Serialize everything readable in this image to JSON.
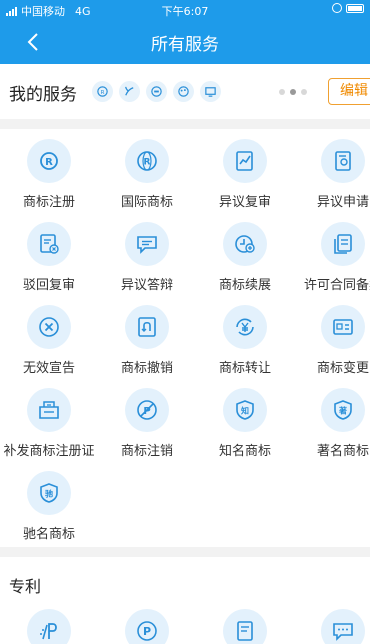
{
  "status_bar": {
    "carrier": "中国移动",
    "network": "4G",
    "time": "下午6:07"
  },
  "navbar": {
    "title": "所有服务"
  },
  "my_services": {
    "title": "我的服务",
    "icons": [
      "trademark-r-icon",
      "sprout-icon",
      "circle-badge-icon",
      "palette-icon",
      "monitor-icon"
    ],
    "edit_label": "编辑"
  },
  "trademark": {
    "items": [
      {
        "label": "商标注册",
        "icon": "registered-r-icon"
      },
      {
        "label": "国际商标",
        "icon": "international-r-icon"
      },
      {
        "label": "异议复审",
        "icon": "chart-review-icon"
      },
      {
        "label": "异议申请",
        "icon": "document-stamp-icon"
      },
      {
        "label": "驳回复审",
        "icon": "document-reject-icon"
      },
      {
        "label": "异议答辩",
        "icon": "chat-bubble-icon"
      },
      {
        "label": "商标续展",
        "icon": "clock-plus-icon"
      },
      {
        "label": "许可合同备案",
        "icon": "contract-copy-icon"
      },
      {
        "label": "无效宣告",
        "icon": "circle-x-icon"
      },
      {
        "label": "商标撤销",
        "icon": "revoke-icon"
      },
      {
        "label": "商标转让",
        "icon": "yen-transfer-icon"
      },
      {
        "label": "商标变更",
        "icon": "card-change-icon"
      },
      {
        "label": "补发商标注册证",
        "icon": "certificate-icon"
      },
      {
        "label": "商标注销",
        "icon": "cancel-p-icon"
      },
      {
        "label": "知名商标",
        "icon": "shield-zhi-icon"
      },
      {
        "label": "著名商标",
        "icon": "shield-zhu-icon"
      },
      {
        "label": "驰名商标",
        "icon": "shield-chi-icon"
      }
    ]
  },
  "patent": {
    "title": "专利",
    "items": [
      {
        "icon": "patent-p-icon"
      },
      {
        "icon": "patent-circle-p-icon"
      },
      {
        "icon": "patent-document-icon"
      },
      {
        "icon": "patent-chat-icon"
      }
    ]
  },
  "colors": {
    "primary": "#1e9bea",
    "icon_bg": "#e3f1fc",
    "edit_accent": "#f08a00"
  }
}
